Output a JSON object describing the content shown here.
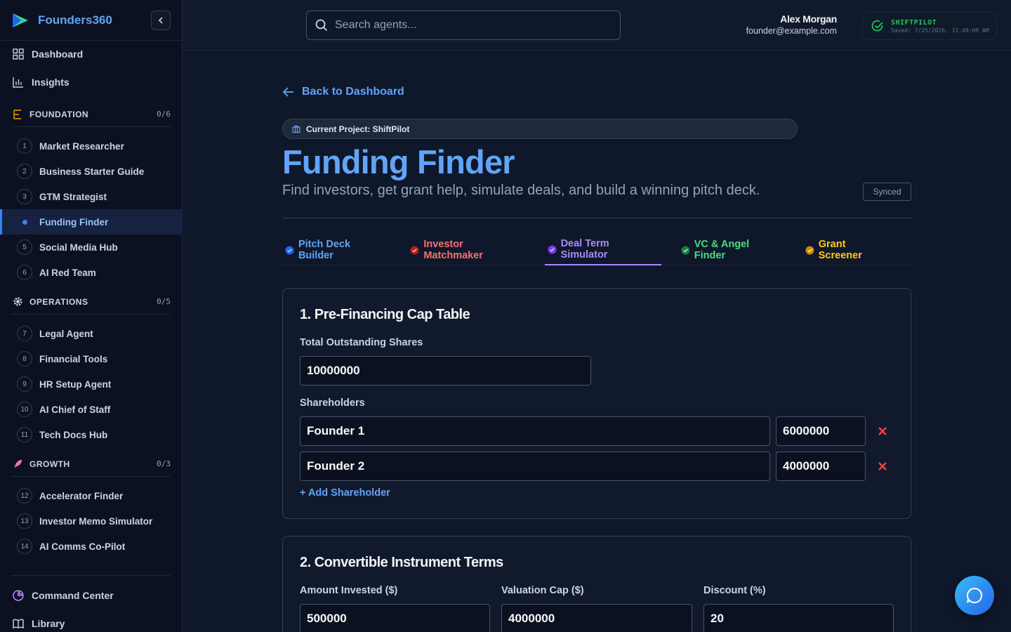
{
  "brand": {
    "name": "Founders360"
  },
  "nav": {
    "dashboard": "Dashboard",
    "insights": "Insights",
    "command_center": "Command Center",
    "library": "Library"
  },
  "sections": {
    "foundation": {
      "title": "FOUNDATION",
      "count": "0/6"
    },
    "operations": {
      "title": "OPERATIONS",
      "count": "0/5"
    },
    "growth": {
      "title": "GROWTH",
      "count": "0/3"
    }
  },
  "agents": {
    "foundation": [
      {
        "num": "1",
        "label": "Market Researcher"
      },
      {
        "num": "2",
        "label": "Business Starter Guide"
      },
      {
        "num": "3",
        "label": "GTM Strategist"
      },
      {
        "num": "4",
        "label": "Funding Finder"
      },
      {
        "num": "5",
        "label": "Social Media Hub"
      },
      {
        "num": "6",
        "label": "AI Red Team"
      }
    ],
    "operations": [
      {
        "num": "7",
        "label": "Legal Agent"
      },
      {
        "num": "8",
        "label": "Financial Tools"
      },
      {
        "num": "9",
        "label": "HR Setup Agent"
      },
      {
        "num": "10",
        "label": "AI Chief of Staff"
      },
      {
        "num": "11",
        "label": "Tech Docs Hub"
      }
    ],
    "growth": [
      {
        "num": "12",
        "label": "Accelerator Finder"
      },
      {
        "num": "13",
        "label": "Investor Memo Simulator"
      },
      {
        "num": "14",
        "label": "AI Comms Co-Pilot"
      }
    ]
  },
  "header": {
    "search_placeholder": "Search agents...",
    "user_name": "Alex Morgan",
    "user_email": "founder@example.com",
    "save_title": "SHIFTPILOT",
    "save_time": "Saved: 7/25/2026, 11:49:09 AM"
  },
  "page": {
    "back_label": "Back to Dashboard",
    "project_label": "Current Project: ShiftPilot",
    "title": "Funding Finder",
    "subtitle": "Find investors, get grant help, simulate deals, and build a winning pitch deck.",
    "synced": "Synced"
  },
  "tabs": [
    {
      "label": "Pitch Deck Builder",
      "color": "#60a5fa"
    },
    {
      "label": "Investor Matchmaker",
      "color": "#f87171"
    },
    {
      "label": "Deal Term Simulator",
      "color": "#a78bfa"
    },
    {
      "label": "VC & Angel Finder",
      "color": "#4ade80"
    },
    {
      "label": "Grant Screener",
      "color": "#facc15"
    }
  ],
  "cap_table": {
    "heading": "1. Pre-Financing Cap Table",
    "total_label": "Total Outstanding Shares",
    "total_value": "10000000",
    "shareholders_label": "Shareholders",
    "shareholders": [
      {
        "name": "Founder 1",
        "shares": "6000000"
      },
      {
        "name": "Founder 2",
        "shares": "4000000"
      }
    ],
    "add_label": "+ Add Shareholder"
  },
  "convertible": {
    "heading": "2. Convertible Instrument Terms",
    "amount_label": "Amount Invested ($)",
    "amount_value": "500000",
    "cap_label": "Valuation Cap ($)",
    "cap_value": "4000000",
    "discount_label": "Discount (%)",
    "discount_value": "20"
  }
}
